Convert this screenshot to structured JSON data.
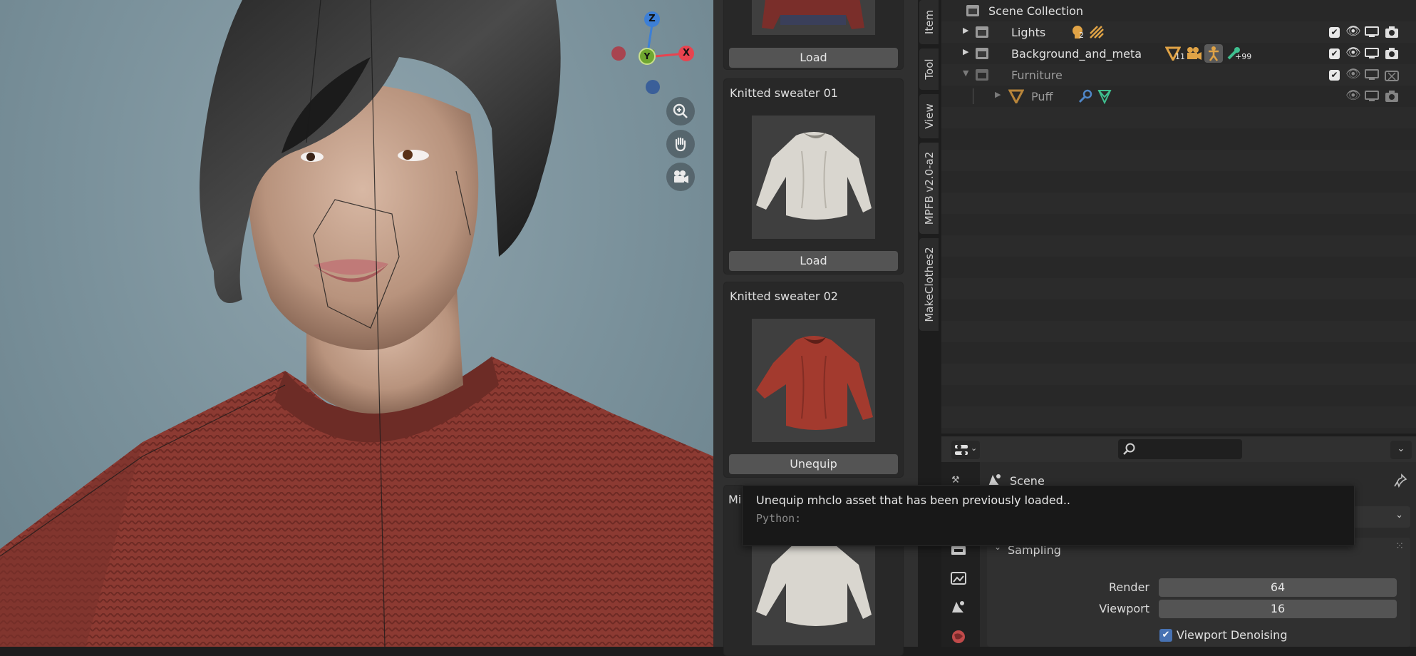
{
  "viewport": {
    "gizmo": {
      "z": "Z",
      "y": "Y",
      "x": "X"
    },
    "nav_icons": [
      "zoom-icon",
      "hand-pan-icon",
      "camera-icon"
    ]
  },
  "sidebar": {
    "cards": [
      {
        "title": "",
        "button": "Load"
      },
      {
        "title": "Knitted sweater 01",
        "button": "Load"
      },
      {
        "title": "Knitted sweater 02",
        "button": "Unequip"
      },
      {
        "title": "Mi",
        "button": ""
      }
    ]
  },
  "tabs": [
    "Item",
    "Tool",
    "View",
    "MPFB v2.0-a2",
    "MakeClothes2"
  ],
  "outliner": {
    "root": "Scene Collection",
    "rows": [
      {
        "name": "Lights",
        "badge": "2"
      },
      {
        "name": "Background_and_meta",
        "badge": "11",
        "badge2": "+99"
      },
      {
        "name": "Furniture"
      },
      {
        "name": "Puff"
      }
    ]
  },
  "properties": {
    "tab": "Scene",
    "section": "Sampling",
    "render_label": "Render",
    "render_value": "64",
    "viewport_label": "Viewport",
    "viewport_value": "16",
    "denoise_label": "Viewport Denoising"
  },
  "tooltip": {
    "text": "Unequip mhclo asset that has been previously loaded..",
    "python": "Python:"
  },
  "colors": {
    "accent_blue": "#4772b3",
    "x_axis": "#e8434f",
    "y_axis": "#6fa630",
    "z_axis": "#3d7fd6",
    "outliner_orange": "#e0a346",
    "sweater_red": "#8c3a32"
  }
}
